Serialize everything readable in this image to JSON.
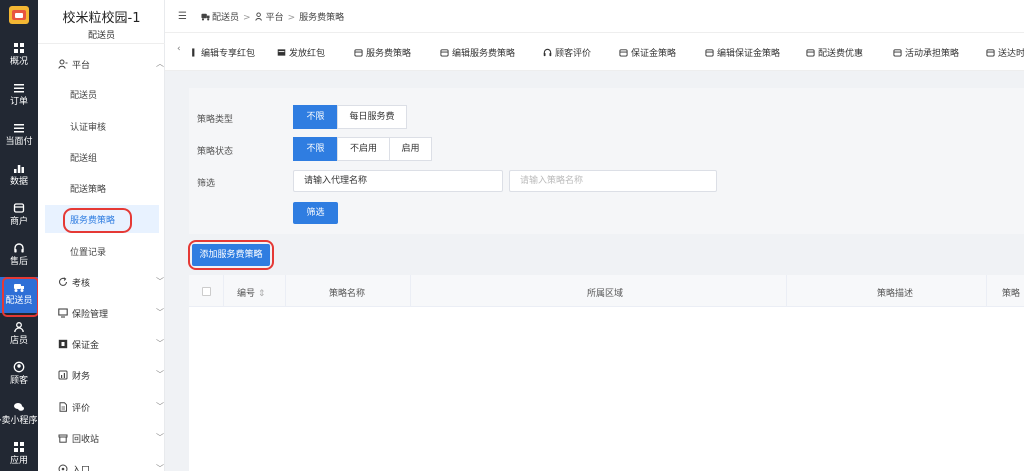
{
  "rail": {
    "items": [
      {
        "label": "概况",
        "icon": "grid-icon"
      },
      {
        "label": "订单",
        "icon": "list-icon"
      },
      {
        "label": "当面付",
        "icon": "list-icon"
      },
      {
        "label": "数据",
        "icon": "bar-chart-icon"
      },
      {
        "label": "商户",
        "icon": "store-icon"
      },
      {
        "label": "售后",
        "icon": "headset-icon"
      },
      {
        "label": "配送员",
        "icon": "delivery-icon"
      },
      {
        "label": "店员",
        "icon": "user-icon"
      },
      {
        "label": "顾客",
        "icon": "customer-icon"
      },
      {
        "label": "外卖小程序",
        "icon": "wechat-icon"
      },
      {
        "label": "应用",
        "icon": "apps-icon"
      }
    ]
  },
  "sidebar": {
    "brand": "校米粒校园-1",
    "role": "配送员",
    "groups": [
      {
        "label": "平台",
        "icon": "people-icon",
        "chevron": "︿"
      },
      {
        "label": "考核",
        "icon": "refresh-icon",
        "chevron": "﹀"
      },
      {
        "label": "保险管理",
        "icon": "monitor-icon",
        "chevron": "﹀"
      },
      {
        "label": "保证金",
        "icon": "deposit-icon",
        "chevron": "﹀"
      },
      {
        "label": "财务",
        "icon": "finance-icon",
        "chevron": "﹀"
      },
      {
        "label": "评价",
        "icon": "document-icon",
        "chevron": "﹀"
      },
      {
        "label": "回收站",
        "icon": "trash-icon",
        "chevron": "﹀"
      },
      {
        "label": "入口",
        "icon": "entry-icon",
        "chevron": "﹀"
      }
    ],
    "platform_items": [
      "配送员",
      "认证审核",
      "配送组",
      "配送策略",
      "服务费策略",
      "位置记录"
    ]
  },
  "header": {
    "menu_icon": "☰",
    "breadcrumb": [
      "配送员",
      "平台",
      "服务费策略"
    ],
    "separator": ">"
  },
  "tabs": {
    "left_arrow": "‹",
    "items": [
      "编辑专享红包",
      "发放红包",
      "服务费策略",
      "编辑服务费策略",
      "顾客评价",
      "保证金策略",
      "编辑保证金策略",
      "配送费优惠",
      "活动承担策略",
      "送达时"
    ]
  },
  "filters": {
    "type_label": "策略类型",
    "type_options": [
      "不限",
      "每日服务费"
    ],
    "status_label": "策略状态",
    "status_options": [
      "不限",
      "不启用",
      "启用"
    ],
    "filter_label": "筛选",
    "agent_input_value": "请输入代理名称",
    "strategy_input_placeholder": "请输入策略名称",
    "filter_button": "筛选"
  },
  "actions": {
    "add_button": "添加服务费策略"
  },
  "table": {
    "columns": [
      "编号",
      "策略名称",
      "所属区域",
      "策略描述",
      "策略"
    ],
    "sort_icon": "⇕"
  },
  "colors": {
    "accent": "#2f7de1",
    "rail_bg": "#222833",
    "highlight": "#e53935"
  }
}
